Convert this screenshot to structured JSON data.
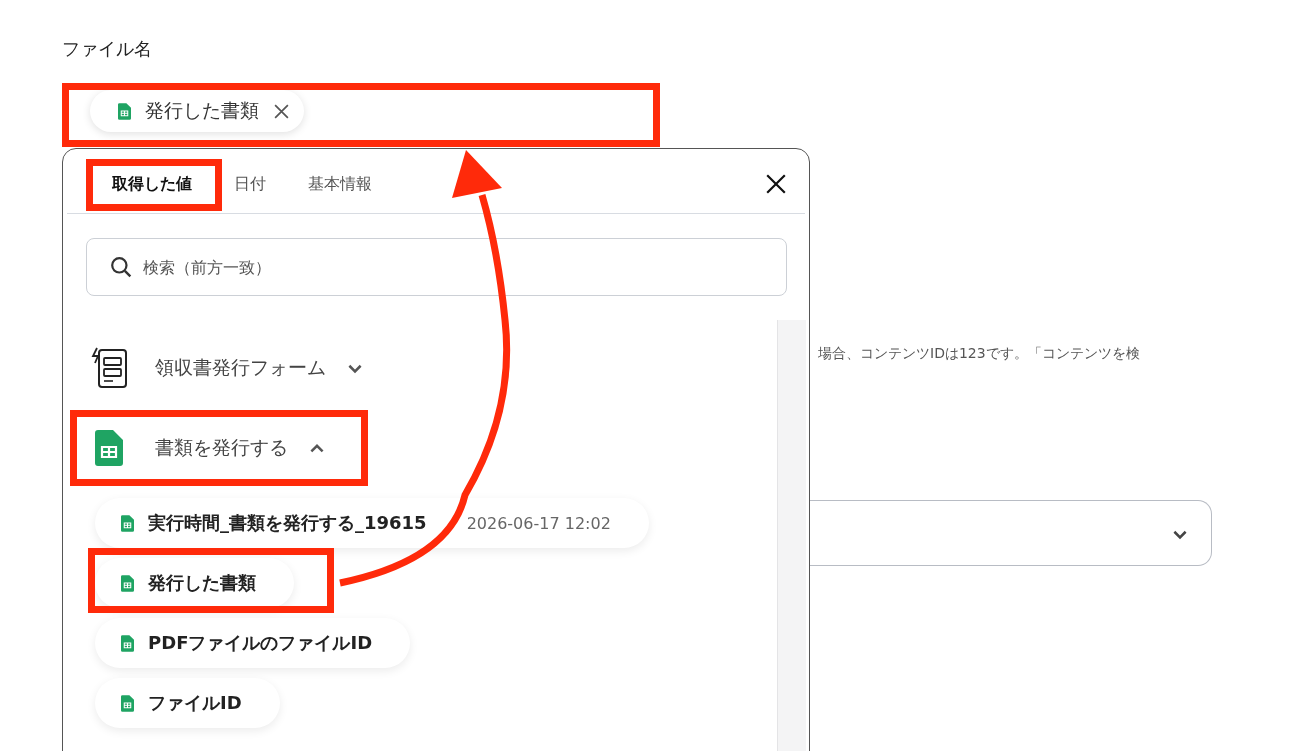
{
  "field": {
    "label": "ファイル名",
    "chips": [
      {
        "text": "発行した書類"
      }
    ]
  },
  "popup": {
    "tabs": [
      {
        "label": "取得した値",
        "selected": true
      },
      {
        "label": "日付",
        "selected": false
      },
      {
        "label": "基本情報",
        "selected": false
      }
    ],
    "search": {
      "placeholder": "検索（前方一致）"
    },
    "groups": [
      {
        "kind": "form",
        "title": "領収書発行フォーム",
        "expanded": false
      },
      {
        "kind": "sheet",
        "title": "書類を発行する",
        "expanded": true,
        "children": [
          {
            "label": "実行時間_書類を発行する_19615",
            "meta": "2026-06-17 12:02"
          },
          {
            "label": "発行した書類"
          },
          {
            "label": "PDFファイルのファイルID"
          },
          {
            "label": "ファイルID"
          }
        ]
      }
    ]
  },
  "background": {
    "help_text": "場合、コンテンツIDは123です。「コンテンツを検"
  }
}
